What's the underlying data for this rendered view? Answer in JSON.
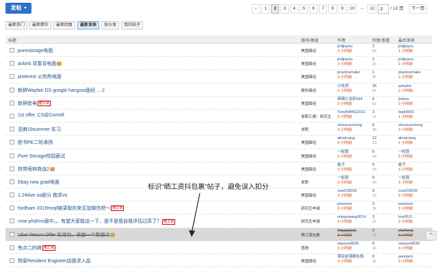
{
  "toolbar": {
    "post_label": "发帖"
  },
  "pager": {
    "prev": "‹",
    "pages": [
      "1",
      "2",
      "3",
      "4",
      "5",
      "6",
      "7",
      "8",
      "9",
      "10",
      "...",
      "12"
    ],
    "current": "2",
    "input_value": "2",
    "total": "/ 12 页",
    "next": "下一页"
  },
  "tabs": [
    "最新热门",
    "最新精华",
    "最新回复",
    "最新发表",
    "抢沙发",
    "我的帖子"
  ],
  "active_tab": 3,
  "header": {
    "title": "标题",
    "category": "版块/类组",
    "author": "作者",
    "replies": "回复/查看",
    "last": "最后发表"
  },
  "rows": [
    {
      "title": "purestorage电面",
      "badge": "",
      "pic": false,
      "cat": "美国面经",
      "author": "jinlijiayou",
      "adate": "3 小时前",
      "r": "2",
      "v": "84",
      "last": "jinlijiayou",
      "ldate": "1 小时前"
    },
    {
      "title": "airbnb 背靠背电面",
      "badge": "",
      "pic": true,
      "cat": "美国面经",
      "author": "jinlijiayou",
      "adate": "3 小时前",
      "r": "2",
      "v": "26",
      "last": "jinlijiayou",
      "ldate": "1 小时前"
    },
    {
      "title": "pinterest 火热热电面",
      "badge": "",
      "pic": false,
      "cat": "美国面经",
      "author": "practicemake",
      "adate": "3 小时前",
      "r": "1",
      "v": "55",
      "last": "practicemake",
      "ldate": "3 小时前"
    },
    {
      "title": "新鲜Wayfair DS google hangout面经 ... 2",
      "badge": "",
      "pic": false,
      "cat": "数科面经",
      "author": "小吃货",
      "adate": "3 小时前",
      "r": "15",
      "v": "91",
      "last": "poisytre",
      "ldate": "3 小时前"
    },
    {
      "title": "新鲜脸电",
      "badge": "晒工资",
      "pic": false,
      "cat": "美国面经",
      "author": "麻辣小龙虾694",
      "adate": "3 小时前",
      "r": "0",
      "v": "62",
      "last": "jhdyss",
      "ldate": "3 小时前"
    },
    {
      "title": "1st offer, CS@Cornell",
      "badge": "",
      "pic": false,
      "cat": "录取汇报：研究生",
      "author": "TonyWANG2012",
      "adate": "3 小时前",
      "r": "3",
      "v": "11",
      "last": "bupt0001",
      "ldate": "1 小时前"
    },
    {
      "title": "亚麻19summer 实习",
      "badge": "",
      "pic": false,
      "cat": "求职",
      "author": "zhouxuncheng",
      "adate": "3 小时前",
      "r": "0",
      "v": "36",
      "last": "zhouxuncheng",
      "ldate": "3 小时前"
    },
    {
      "title": "脸书PE二轮承扬",
      "badge": "",
      "pic": false,
      "cat": "美国面经",
      "author": "akraiLiang",
      "adate": "3 小时前",
      "r": "12",
      "v": "10",
      "last": "akraiLiang",
      "ldate": "1 小时前"
    },
    {
      "title": "Pure Storage校园面试",
      "badge": "",
      "pic": false,
      "cat": "美国面经",
      "author": "一粒取",
      "adate": "3 小时前",
      "r": "0",
      "v": "44",
      "last": "一粒取",
      "ldate": "3 小时前"
    },
    {
      "title": "热带雨林商战2",
      "badge": "",
      "pic": true,
      "cat": "美国面经",
      "author": "蛤子",
      "adate": "3 小时前",
      "r": "0",
      "v": "34",
      "last": "蛤子",
      "ldate": "3 小时前"
    },
    {
      "title": "Ebay new grad电面",
      "badge": "",
      "pic": false,
      "cat": "求职",
      "author": "一粒取",
      "adate": "3 小时前",
      "r": "0",
      "v": "34",
      "last": "一粒取",
      "ldate": "3 小时前"
    },
    {
      "title": "1.24due oa部分 抱求vo",
      "badge": "",
      "pic": false,
      "cat": "美国面经",
      "author": "zxw018018",
      "adate": "3 小时前",
      "r": "0",
      "v": "26",
      "last": "zxw018018",
      "ldate": "3 小时前"
    },
    {
      "title": "fordham 2019msqf被录取的来互加微信吧～",
      "badge": "晒工资",
      "pic": false,
      "cat": "研究生申请",
      "author": "pxwxoxo",
      "adate": "3 小时前",
      "r": "3",
      "v": "39",
      "last": "pxwxoxo",
      "ldate": "3 小时前"
    },
    {
      "title": "rnse phd/ms眉中。。有望大家能谈一下，是不是我自我评估过高了？",
      "badge": "晒工资",
      "pic": false,
      "cat": "研究生申请",
      "author": "mingyiwang3014",
      "adate": "3 小时前",
      "r": "3",
      "v": "12",
      "last": "lmy0611",
      "ldate": "3 小时前"
    },
    {
      "title": "Uber Return Offer 标准包，贡献一个数据点",
      "badge": "",
      "pic": true,
      "cat": "晒工资包裹",
      "author": "llllggggkjsjk",
      "adate": "3 小时前",
      "r": "0",
      "v": "28",
      "last": "zlczhong",
      "ldate": "3 小时前",
      "gray": true
    },
    {
      "title": "有点二的碑",
      "badge": "晒工资",
      "pic": false,
      "cat": "宽物",
      "author": "xiaoyue8536",
      "adate": "3 小时前",
      "r": "0",
      "v": "16",
      "last": "xiaoyue8536",
      "ldate": "3 小时前"
    },
    {
      "title": "狗家Resident Engineer店面求入品",
      "badge": "",
      "pic": false,
      "cat": "美国面经",
      "author": "我目前落脚在和",
      "adate": "3 小时前",
      "r": "0",
      "v": "42",
      "last": "pandami",
      "ldate": "3 小时前"
    }
  ],
  "annotation": "标识“晒工资抖包裹”帖子，避免误入扣分",
  "colors": {
    "brand": "#2f71c3",
    "link": "#1d4f8a",
    "date": "#d04000"
  }
}
